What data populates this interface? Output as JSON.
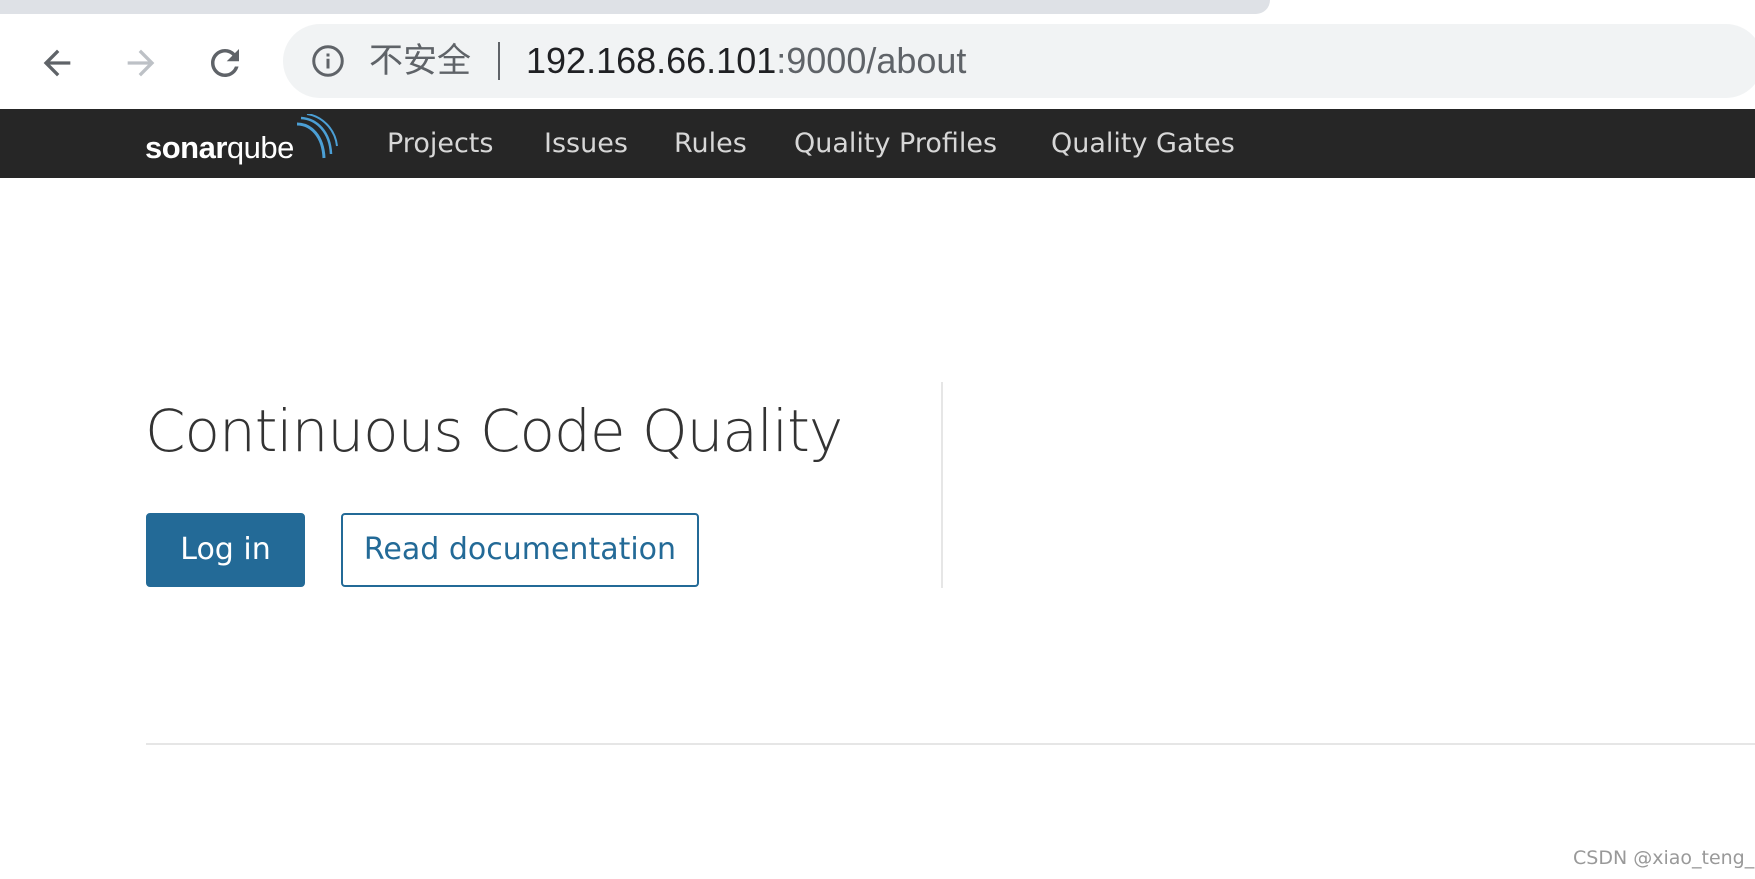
{
  "browser": {
    "security_label": "不安全",
    "url_host": "192.168.66.101",
    "url_rest": ":9000/about"
  },
  "navbar": {
    "logo_bold": "sonar",
    "logo_light": "qube",
    "items": [
      {
        "label": "Projects"
      },
      {
        "label": "Issues"
      },
      {
        "label": "Rules"
      },
      {
        "label": "Quality Profiles"
      },
      {
        "label": "Quality Gates"
      }
    ]
  },
  "main": {
    "title": "Continuous Code Quality",
    "login_label": "Log in",
    "docs_label": "Read documentation"
  },
  "watermark": "CSDN @xiao_teng_",
  "colors": {
    "navbar_bg": "#262626",
    "primary": "#236a97",
    "omnibox_bg": "#f1f3f4"
  }
}
